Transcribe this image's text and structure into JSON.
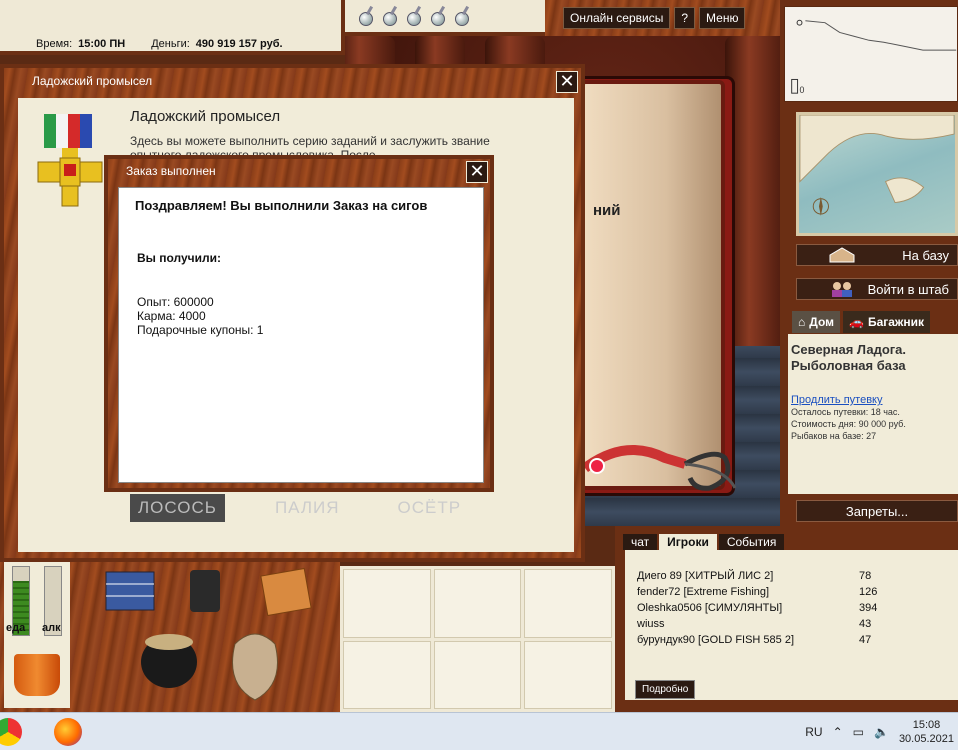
{
  "status": {
    "time_label": "Время:",
    "time_value": "15:00 ПН",
    "money_label": "Деньги:",
    "money_value": "490 919 157 руб."
  },
  "top_buttons": {
    "online_services": "Онлайн сервисы",
    "help": "?",
    "menu": "Меню"
  },
  "scene": {
    "book_text": "ний"
  },
  "right_panel": {
    "to_base": "На базу",
    "enter_hq": "Войти в штаб",
    "home_tab": "Дом",
    "trunk_tab": "Багажник",
    "base_title": "Северная Ладога. Рыболовная база",
    "extend_link": "Продлить путевку",
    "remaining": "Осталось путевки: 18 час.",
    "day_cost": "Стоимость дня: 90 000 руб.",
    "fishers_on_base": "Рыбаков на базе: 27",
    "bans_button": "Запреты...",
    "depth_label": "0"
  },
  "meters": {
    "food_label": "еда",
    "alc_label": "алк",
    "food_level": 0.8,
    "alc_level": 0.0
  },
  "chat": {
    "tabs": [
      "чат",
      "Игроки",
      "События"
    ],
    "active_tab": "Игроки",
    "players": [
      {
        "name": "Диего 89 [ХИТРЫЙ ЛИС 2]",
        "level": "78"
      },
      {
        "name": "fender72 [Extreme Fishing]",
        "level": "126"
      },
      {
        "name": "Oleshka0506 [СИМУЛЯНТЫ]",
        "level": "394"
      },
      {
        "name": "wiuss",
        "level": "43"
      },
      {
        "name": "бурундук90 [GOLD FISH 585 2]",
        "level": "47"
      }
    ],
    "more_button": "Подробно"
  },
  "quest_dialog": {
    "window_title": "Ладожский промысел",
    "heading": "Ладожский промысел",
    "description": "Здесь вы можете выполнить серию заданий и заслужить звание опытного ладожского промысловика. После",
    "fish_tabs": [
      "ЛОСОСЬ",
      "ПАЛИЯ",
      "ОСЁТР"
    ],
    "active_fish": "ЛОСОСЬ"
  },
  "order_dialog": {
    "window_title": "Заказ выполнен",
    "headline": "Поздравляем! Вы выполнили Заказ на сигов",
    "received_label": "Вы получили:",
    "rewards": [
      "Опыт: 600000",
      "Карма: 4000",
      "Подарочные купоны: 1"
    ]
  },
  "taskbar": {
    "language": "RU",
    "time": "15:08",
    "date": "30.05.2021"
  },
  "colors": {
    "wood": "#8a3e18",
    "cream": "#f1ecd9",
    "dark_button": "#2b1a12",
    "link": "#1a4fc0"
  }
}
